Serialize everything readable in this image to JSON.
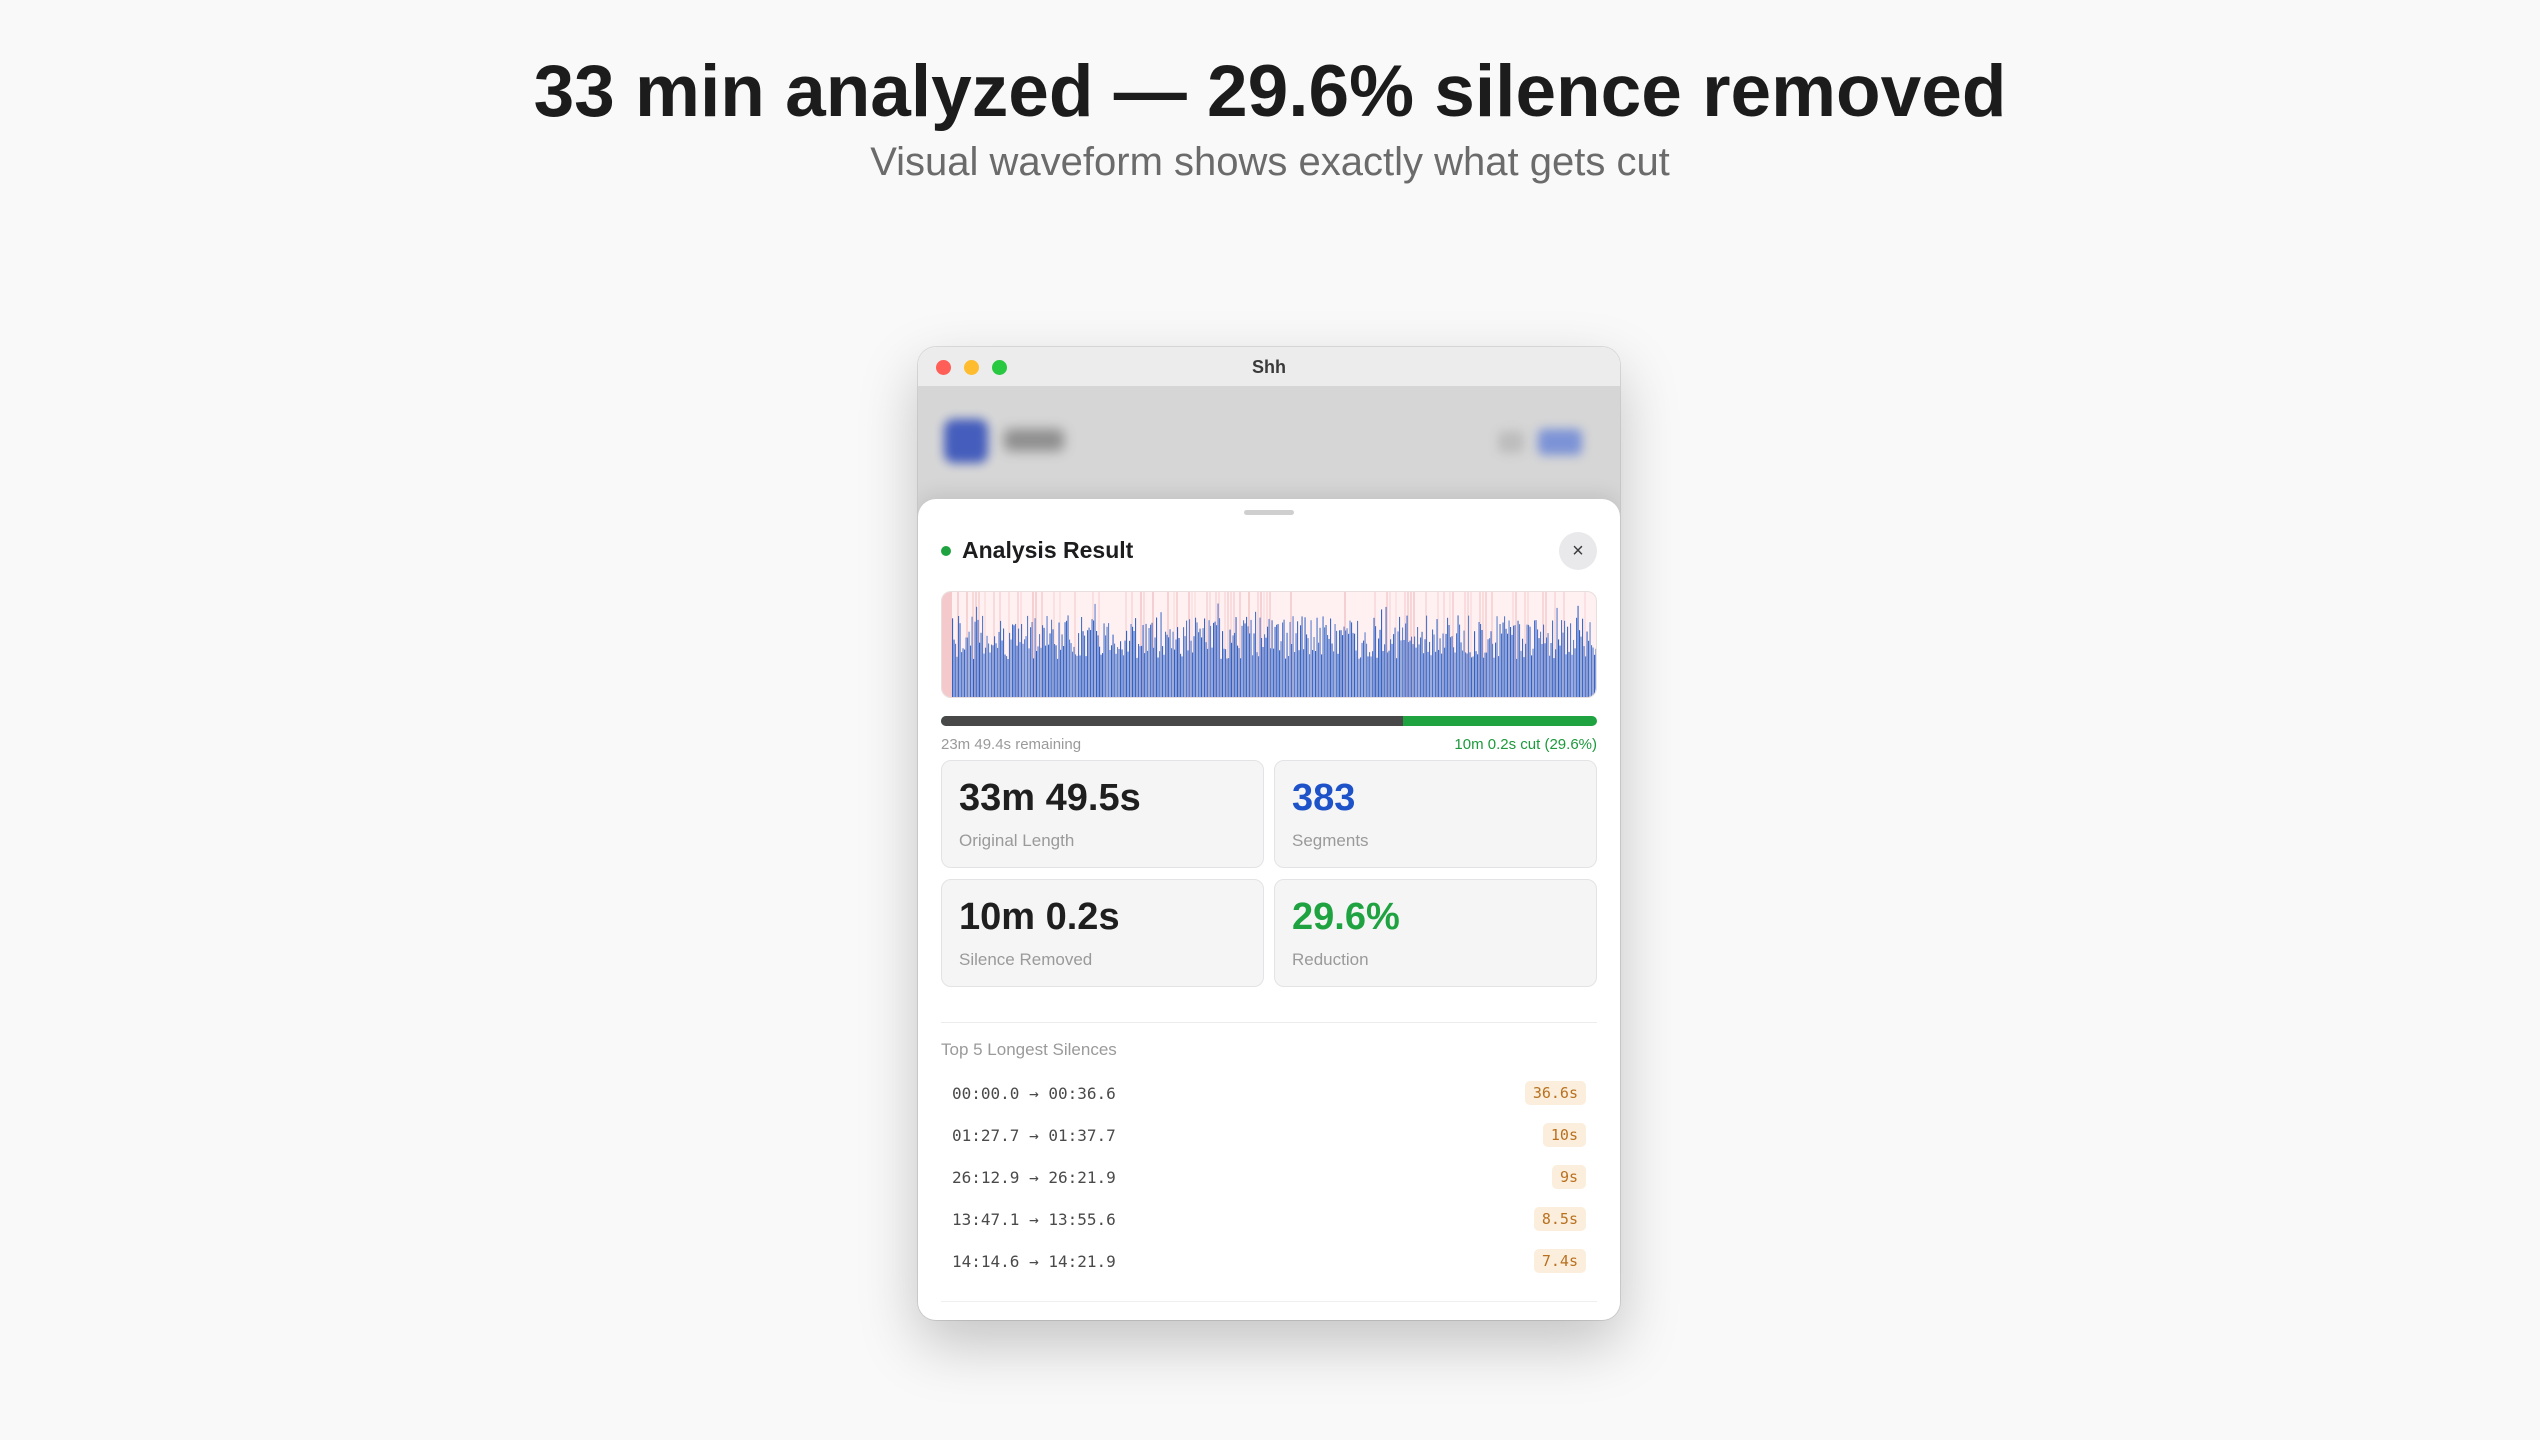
{
  "headline": "33 min analyzed — 29.6% silence removed",
  "subheadline": "Visual waveform shows exactly what gets cut",
  "window": {
    "title": "Shh",
    "traffic_lights": [
      "close",
      "minimize",
      "maximize"
    ]
  },
  "sheet": {
    "title": "Analysis Result",
    "close_label": "×",
    "status_color": "#1fa341"
  },
  "waveform": {
    "wave_color": "#2f5fc4",
    "silence_color": "#f4c9cc",
    "background": "#fff1f1"
  },
  "progress": {
    "remaining_fraction": 0.704,
    "remaining_label": "23m 49.4s remaining",
    "cut_label": "10m 0.2s cut (29.6%)"
  },
  "stats": [
    {
      "value": "33m 49.5s",
      "label": "Original Length",
      "color": "dark"
    },
    {
      "value": "383",
      "label": "Segments",
      "color": "blue"
    },
    {
      "value": "10m 0.2s",
      "label": "Silence Removed",
      "color": "dark"
    },
    {
      "value": "29.6%",
      "label": "Reduction",
      "color": "green"
    }
  ],
  "silences": {
    "title": "Top 5 Longest Silences",
    "items": [
      {
        "range": "00:00.0 → 00:36.6",
        "duration": "36.6s"
      },
      {
        "range": "01:27.7 → 01:37.7",
        "duration": "10s"
      },
      {
        "range": "26:12.9 → 26:21.9",
        "duration": "9s"
      },
      {
        "range": "13:47.1 → 13:55.6",
        "duration": "8.5s"
      },
      {
        "range": "14:14.6 → 14:21.9",
        "duration": "7.4s"
      }
    ]
  }
}
